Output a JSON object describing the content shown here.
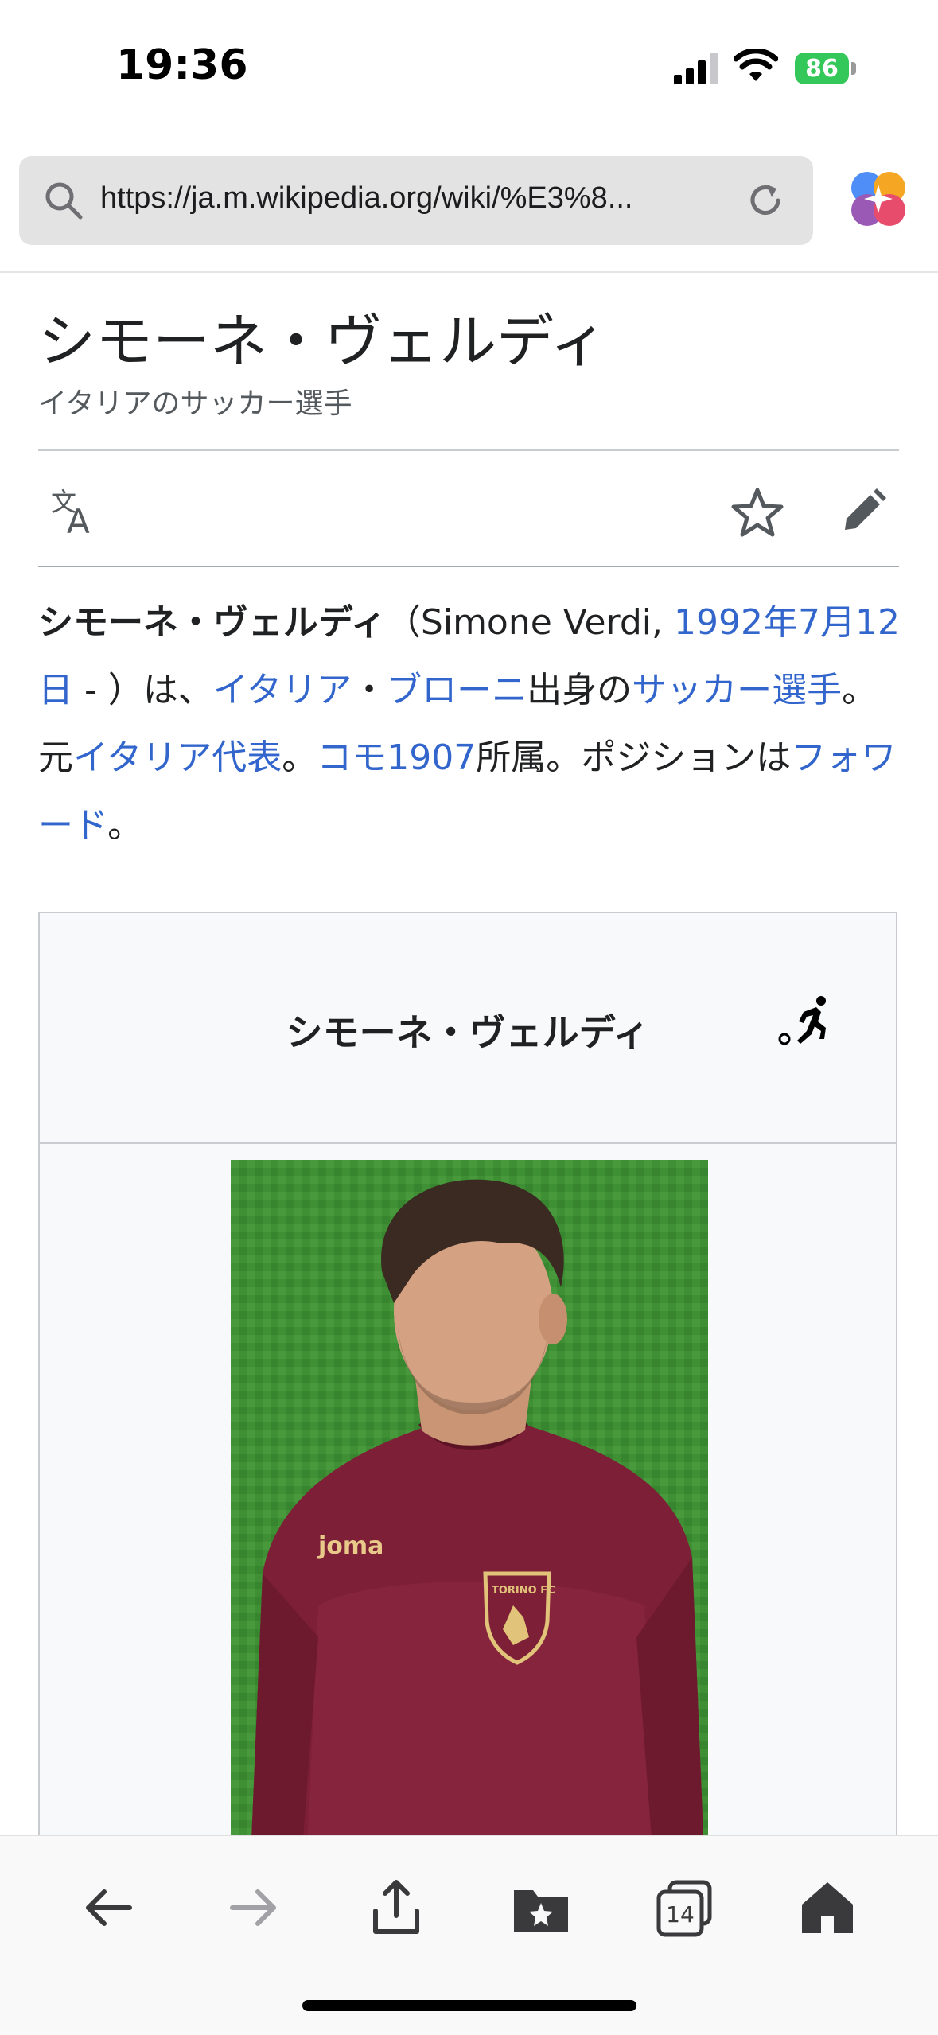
{
  "status": {
    "time": "19:36",
    "battery": "86"
  },
  "browser": {
    "url": "https://ja.m.wikipedia.org/wiki/%E3%8..."
  },
  "article": {
    "title": "シモーネ・ヴェルディ",
    "subtitle": "イタリアのサッカー選手",
    "lead": {
      "name_bold": "シモーネ・ヴェルディ",
      "t1": "（Simone Verdi, ",
      "link_birthdate": "1992年7月12日",
      "t2": " - ）は、",
      "link_country": "イタリア",
      "t3": "・",
      "link_city": "ブローニ",
      "t4": "出身の",
      "link_sport": "サッカー選手",
      "t5": "。元",
      "link_team": "イタリア代表",
      "t6": "。",
      "link_club": "コモ1907",
      "t7": "所属。ポジションは",
      "link_position": "フォワード",
      "t8": "。"
    },
    "infobox": {
      "name": "シモーネ・ヴェルディ",
      "photo_shirt_text": "joma",
      "photo_badge_text": "TORINO FC"
    }
  },
  "toolbar": {
    "tabs_count": "14"
  },
  "colors": {
    "link": "#3366cc",
    "battery": "#34c759"
  }
}
